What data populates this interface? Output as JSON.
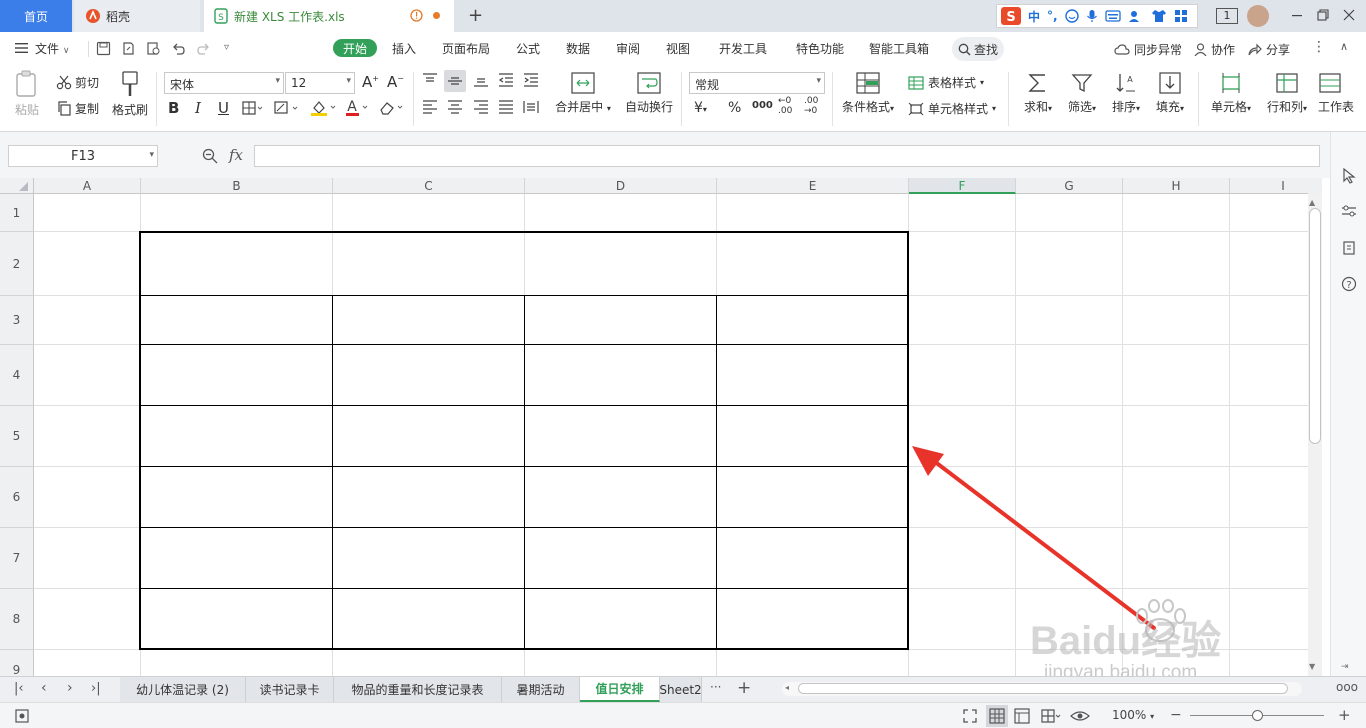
{
  "titlebar": {
    "tab_home": "首页",
    "tab_daoke": "稻壳",
    "tab_file": "新建 XLS 工作表.xls",
    "new_tab": "+",
    "ime_items": [
      "中",
      "°,"
    ],
    "page_indicator": "1"
  },
  "menubar": {
    "items": [
      "开始",
      "插入",
      "页面布局",
      "公式",
      "数据",
      "审阅",
      "视图",
      "开发工具",
      "特色功能",
      "智能工具箱"
    ],
    "file_label": "文件",
    "search_label": "查找",
    "sync_label": "同步异常",
    "collab_label": "协作",
    "share_label": "分享"
  },
  "ribbon": {
    "paste": "粘贴",
    "cut": "剪切",
    "copy": "复制",
    "format_painter": "格式刷",
    "font_name": "宋体",
    "font_size": "12",
    "merge_center": "合并居中",
    "auto_wrap": "自动换行",
    "number_format": "常规",
    "cond_format": "条件格式",
    "table_style": "表格样式",
    "cell_style": "单元格样式",
    "sum": "求和",
    "filter": "筛选",
    "sort": "排序",
    "fill": "填充",
    "cell": "单元格",
    "row_col": "行和列",
    "worksheet": "工作表"
  },
  "formula": {
    "name_box": "F13",
    "fx": "fx",
    "value": ""
  },
  "grid": {
    "columns": [
      "A",
      "B",
      "C",
      "D",
      "E",
      "F",
      "G",
      "H",
      "I"
    ],
    "rows": [
      "1",
      "2",
      "3",
      "4",
      "5",
      "6",
      "7",
      "8",
      "9"
    ],
    "active_column": "F",
    "accent_color": "#33a05a",
    "arrow_color": "#e8332a"
  },
  "sheets": {
    "tabs": [
      "幼儿体温记录 (2)",
      "读书记录卡",
      "物品的重量和长度记录表",
      "暑期活动",
      "值日安排",
      "Sheet2"
    ],
    "active": "值日安排",
    "more": "···",
    "add": "+"
  },
  "status": {
    "zoom": "100%"
  },
  "watermark": {
    "brand": "Baidu经验",
    "url": "jingyan.baidu.com"
  }
}
